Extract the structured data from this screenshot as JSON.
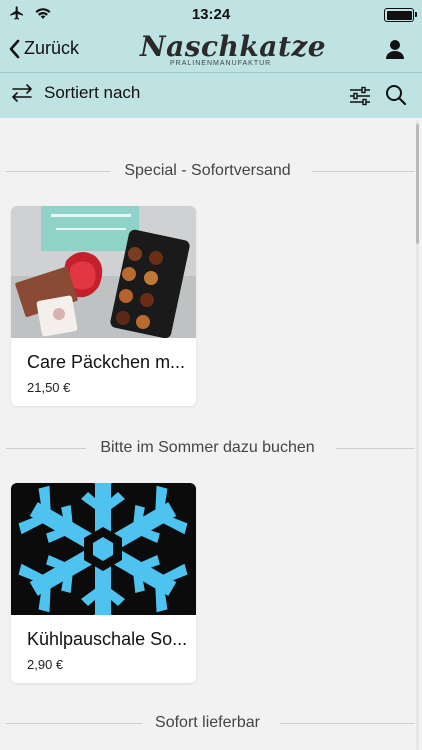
{
  "status": {
    "time": "13:24",
    "airplane_icon": "airplane-icon",
    "wifi_icon": "wifi-icon",
    "battery_icon": "battery-icon"
  },
  "nav": {
    "back_label": "Zurück",
    "logo_text": "Naschkatze",
    "logo_subtitle": "PRALINENMANUFAKTUR",
    "user_icon": "user-icon"
  },
  "toolbar": {
    "sort_label": "Sortiert nach",
    "sort_icon": "sort-arrows-icon",
    "filter_icon": "sliders-icon",
    "search_icon": "search-icon"
  },
  "colors": {
    "header_bg": "#bfe3e2",
    "page_bg": "#f2f2f2",
    "snowflake": "#4fc3f0"
  },
  "sections": [
    {
      "title": "Special - Sofortversand",
      "products": [
        {
          "name": "Care Päckchen m...",
          "price": "21,50 €"
        }
      ]
    },
    {
      "title": "Bitte im Sommer dazu buchen",
      "products": [
        {
          "name": "Kühlpauschale So...",
          "price": "2,90 €"
        }
      ]
    },
    {
      "title": "Sofort lieferbar",
      "products": []
    }
  ]
}
